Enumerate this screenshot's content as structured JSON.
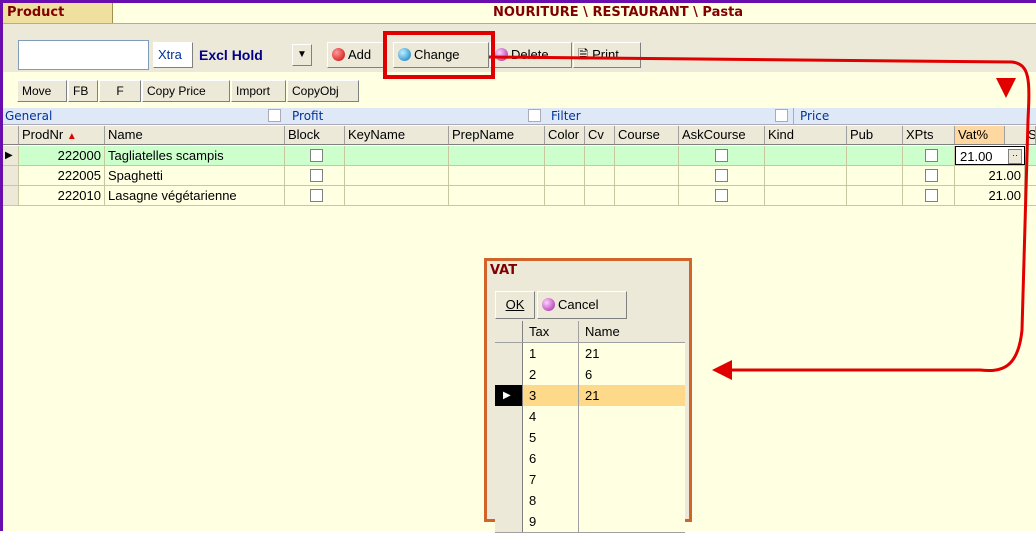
{
  "title_bar": {
    "left": "Product",
    "path": "NOURITURE \\ RESTAURANT \\ Pasta"
  },
  "toolbar": {
    "search_value": "",
    "xtra_label": "Xtra",
    "filter_value": "Excl Hold",
    "add_label": "Add",
    "change_label": "Change",
    "delete_label": "Delete",
    "print_label": "Print"
  },
  "toolbar2": [
    "Move",
    "FB",
    "F",
    "Copy Price",
    "Import",
    "CopyObj"
  ],
  "sections": {
    "general": "General",
    "profit": "Profit",
    "filter": "Filter",
    "price": "Price"
  },
  "columns": [
    "ProdNr",
    "Name",
    "Block",
    "KeyName",
    "PrepName",
    "Color",
    "Cv",
    "Course",
    "AskCourse",
    "Kind",
    "Pub",
    "XPts",
    "Vat%",
    "S"
  ],
  "rows": [
    {
      "prodnr": "222000",
      "name": "Tagliatelles scampis",
      "vat": "21.00",
      "selected": true
    },
    {
      "prodnr": "222005",
      "name": "Spaghetti",
      "vat": "21.00",
      "selected": false
    },
    {
      "prodnr": "222010",
      "name": "Lasagne végétarienne",
      "vat": "21.00",
      "selected": false
    }
  ],
  "vat_dialog": {
    "title": "VAT",
    "ok_label": "OK",
    "cancel_label": "Cancel",
    "col_tax": "Tax",
    "col_name": "Name",
    "rows": [
      {
        "tax": "1",
        "name": "21"
      },
      {
        "tax": "2",
        "name": "6"
      },
      {
        "tax": "3",
        "name": "21"
      },
      {
        "tax": "4",
        "name": ""
      },
      {
        "tax": "5",
        "name": ""
      },
      {
        "tax": "6",
        "name": ""
      },
      {
        "tax": "7",
        "name": ""
      },
      {
        "tax": "8",
        "name": ""
      },
      {
        "tax": "9",
        "name": ""
      }
    ],
    "selected_index": 2
  },
  "colors": {
    "accent_red": "#e00000",
    "dialog_border": "#d0642a",
    "title_text": "#800000",
    "grid_bg": "#ffffe1"
  }
}
